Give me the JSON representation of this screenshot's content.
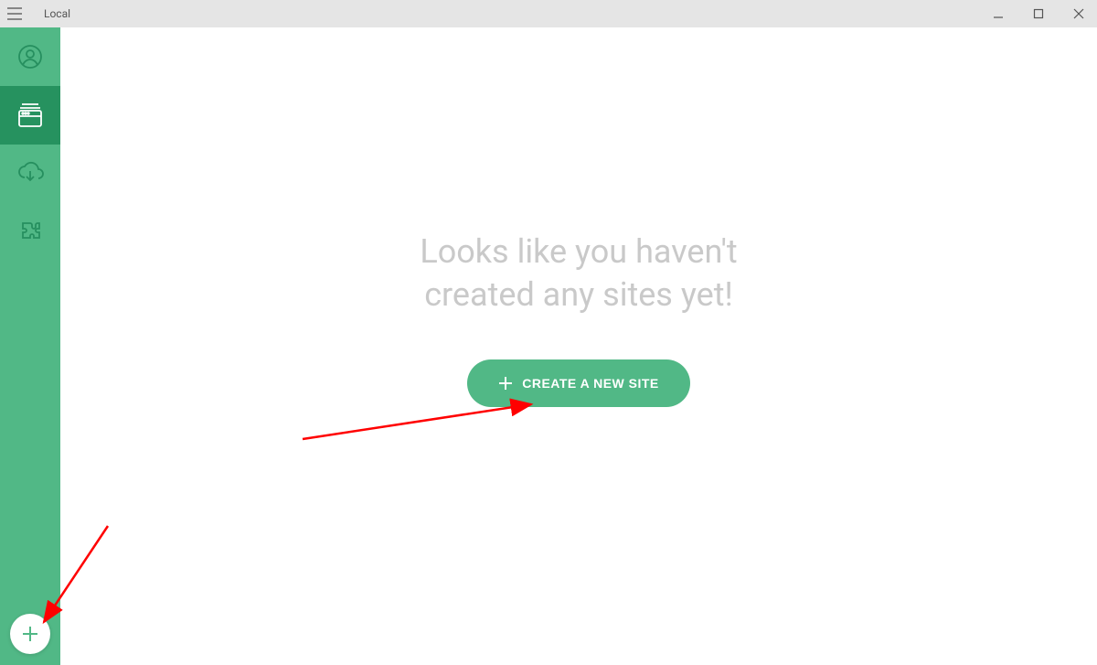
{
  "window": {
    "title": "Local"
  },
  "main": {
    "empty_state_line1": "Looks like you haven't",
    "empty_state_line2": "created any sites yet!",
    "create_button_label": "CREATE A NEW SITE"
  },
  "sidebar": {
    "items": [
      {
        "name": "account"
      },
      {
        "name": "sites",
        "active": true
      },
      {
        "name": "connect"
      },
      {
        "name": "addons"
      }
    ]
  },
  "colors": {
    "brand_green": "#51b886",
    "brand_green_dark": "#26925f",
    "titlebar_bg": "#e5e5e5",
    "muted_text": "#c9c9c9",
    "annotation_red": "#ff0000"
  }
}
